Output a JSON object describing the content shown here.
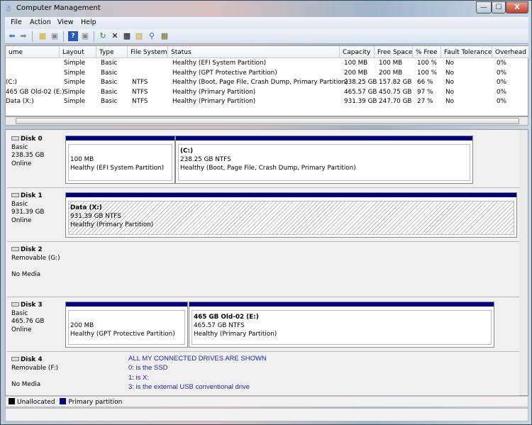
{
  "window": {
    "title": "Computer Management",
    "controls": {
      "minimize": "—",
      "maximize": "☐",
      "close": "X"
    }
  },
  "menu": [
    "File",
    "Action",
    "View",
    "Help"
  ],
  "toolbar": [
    "back-icon",
    "forward-icon",
    "up-folder-icon",
    "console-tree-icon",
    "help-icon",
    "show-hide-icon",
    "refresh-icon",
    "delete-icon",
    "properties-icon",
    "open-icon",
    "search-icon",
    "settings-icon"
  ],
  "list": {
    "columns": [
      "ume",
      "Layout",
      "Type",
      "File System",
      "Status",
      "Capacity",
      "Free Space",
      "% Free",
      "Fault Tolerance",
      "Overhead"
    ],
    "rows": [
      [
        "",
        "Simple",
        "Basic",
        "",
        "Healthy (EFI System Partition)",
        "100 MB",
        "100 MB",
        "100 %",
        "No",
        "0%"
      ],
      [
        "",
        "Simple",
        "Basic",
        "",
        "Healthy (GPT Protective Partition)",
        "200 MB",
        "200 MB",
        "100 %",
        "No",
        "0%"
      ],
      [
        "(C:)",
        "Simple",
        "Basic",
        "NTFS",
        "Healthy (Boot, Page File, Crash Dump, Primary Partition)",
        "238.25 GB",
        "157.82 GB",
        "66 %",
        "No",
        "0%"
      ],
      [
        "465 GB Old-02 (E:)",
        "Simple",
        "Basic",
        "NTFS",
        "Healthy (Primary Partition)",
        "465.57 GB",
        "450.75 GB",
        "97 %",
        "No",
        "0%"
      ],
      [
        "Data (X:)",
        "Simple",
        "Basic",
        "NTFS",
        "Healthy (Primary Partition)",
        "931.39 GB",
        "247.70 GB",
        "27 %",
        "No",
        "0%"
      ]
    ]
  },
  "disks": [
    {
      "name": "Disk 0",
      "lines": [
        "Basic",
        "238.35 GB",
        "Online"
      ],
      "partitions": [
        {
          "title": "",
          "size": "100 MB",
          "status": "Healthy (EFI System Partition)"
        },
        {
          "title": "(C:)",
          "size": "238.25 GB NTFS",
          "status": "Healthy (Boot, Page File, Crash Dump, Primary Partition)"
        }
      ]
    },
    {
      "name": "Disk 1",
      "lines": [
        "Basic",
        "931.39 GB",
        "Online"
      ],
      "partitions": [
        {
          "title": "Data  (X:)",
          "size": "931.39 GB NTFS",
          "status": "Healthy (Primary Partition)"
        }
      ]
    },
    {
      "name": "Disk 2",
      "lines": [
        "Removable (G:)",
        "",
        "No Media"
      ],
      "partitions": []
    },
    {
      "name": "Disk 3",
      "lines": [
        "Basic",
        "465.76 GB",
        "Online"
      ],
      "partitions": [
        {
          "title": "",
          "size": "200 MB",
          "status": "Healthy (GPT Protective Partition)"
        },
        {
          "title": "465 GB Old-02  (E:)",
          "size": "465.57 GB NTFS",
          "status": "Healthy (Primary Partition)"
        }
      ]
    },
    {
      "name": "Disk 4",
      "lines": [
        "Removable (F:)",
        "",
        "No Media"
      ],
      "partitions": []
    }
  ],
  "note": [
    "ALL MY CONNECTED DRIVES ARE SHOWN",
    "0: is the SSD",
    "1: is X:",
    "3: is the external USB conventional drive"
  ],
  "legend": [
    {
      "label": "Unallocated",
      "color": "#000000"
    },
    {
      "label": "Primary partition",
      "color": "#00007f"
    }
  ]
}
